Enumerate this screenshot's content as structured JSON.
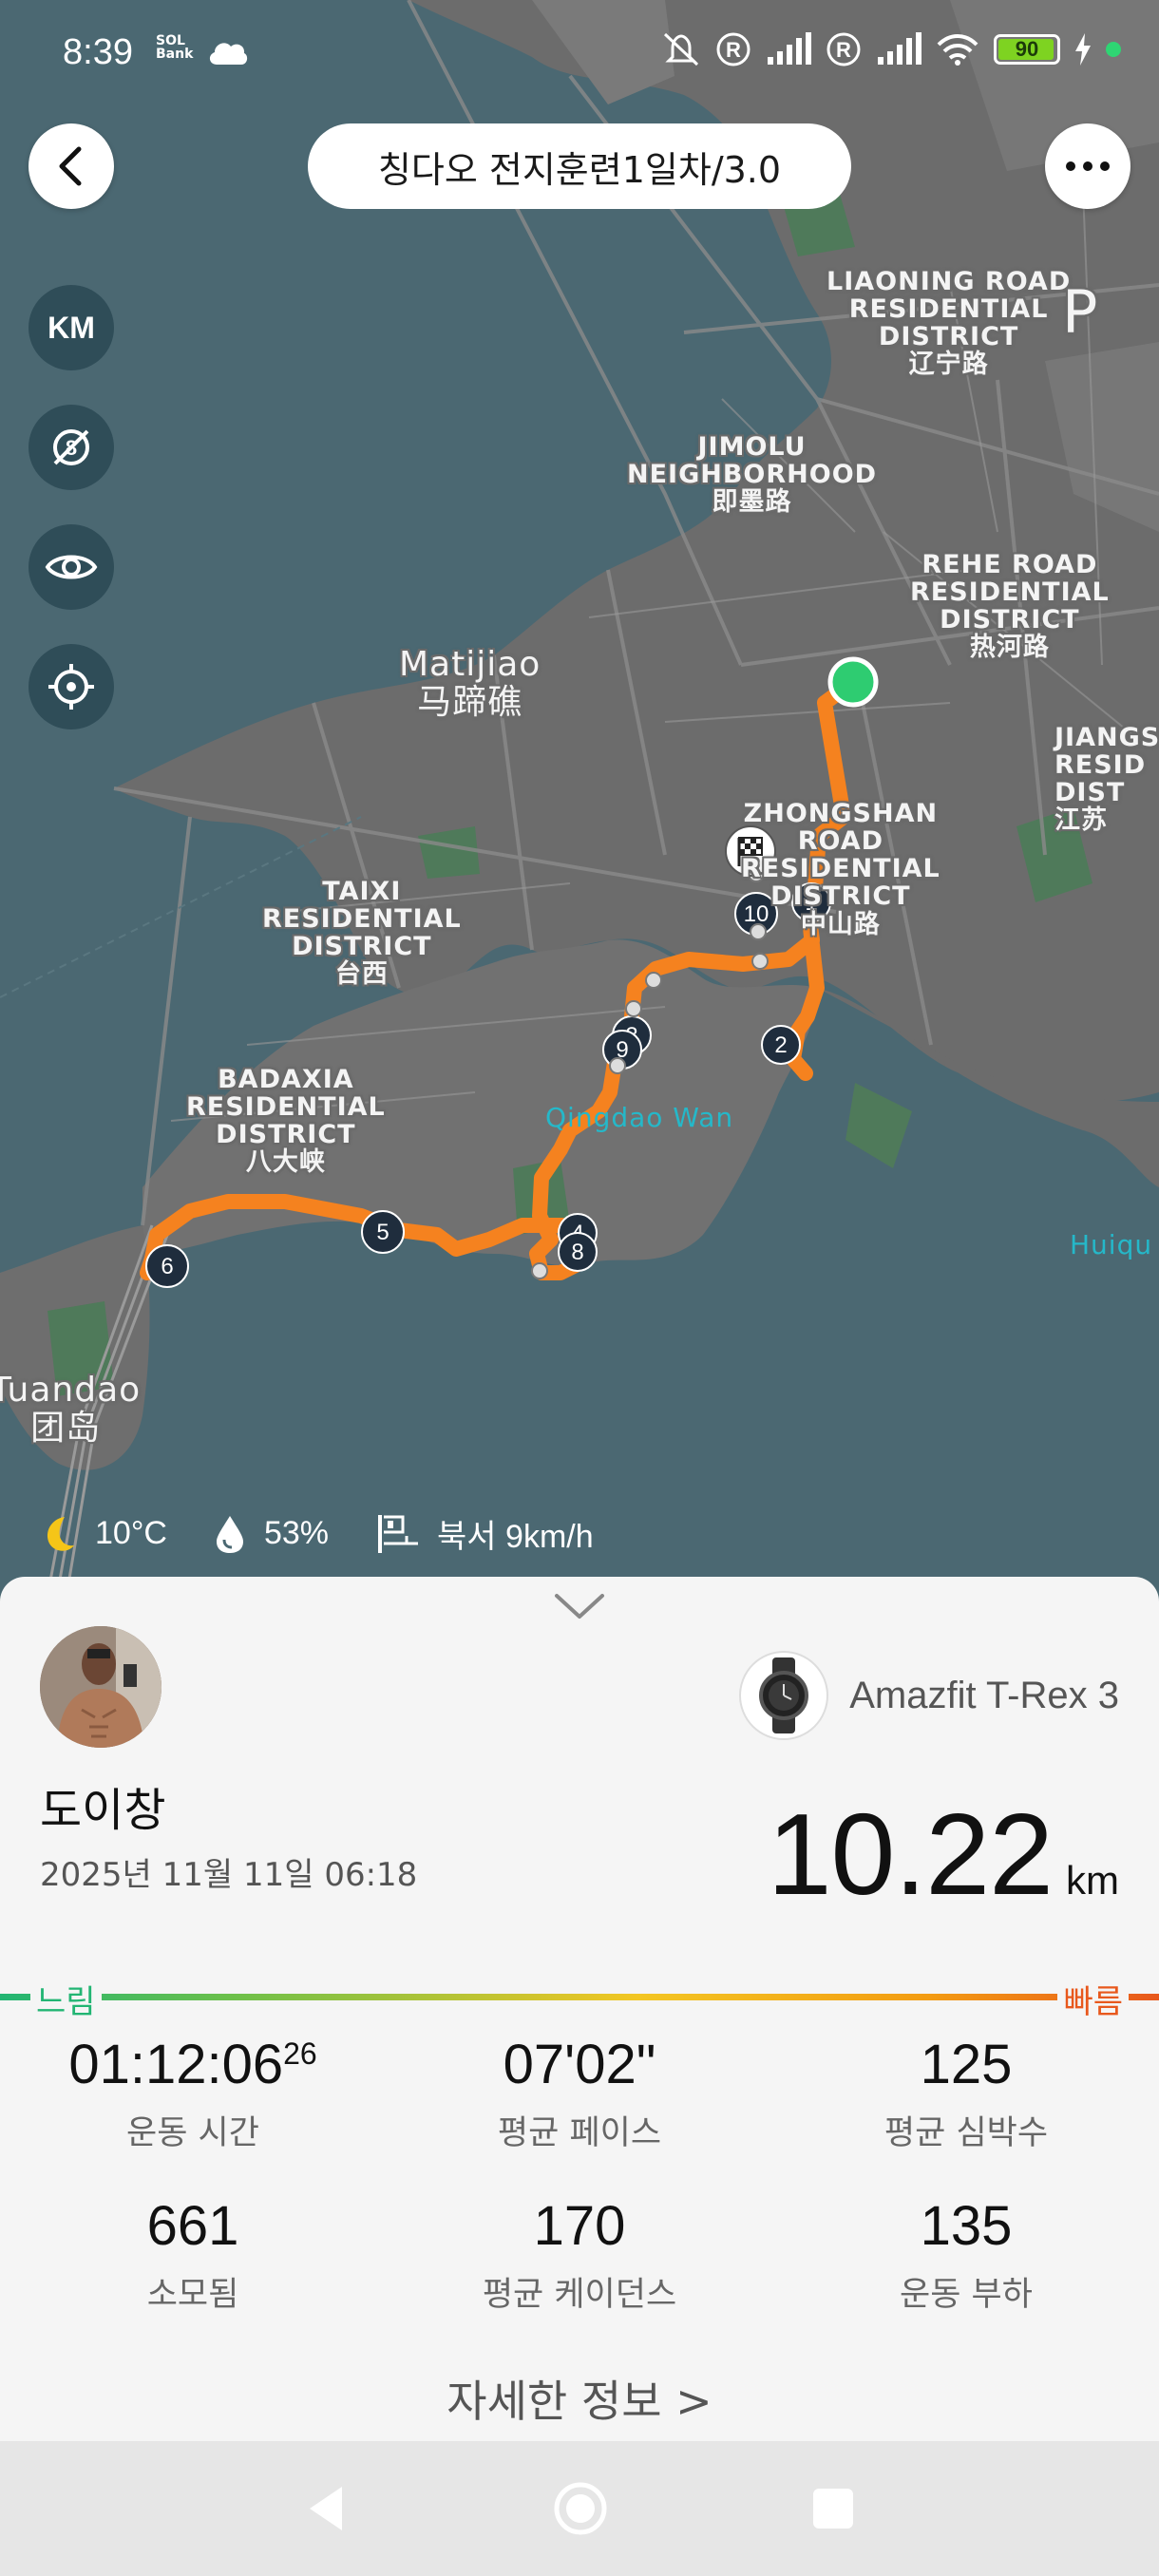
{
  "status_bar": {
    "time": "8:39",
    "bank_text": "SOL Bank",
    "battery": "90"
  },
  "header": {
    "title": "칭다오 전지훈련1일차/3.0"
  },
  "map_controls": {
    "units": "KM"
  },
  "map": {
    "labels": {
      "liaoning": "LIAONING ROAD\nRESIDENTIAL\nDISTRICT\n辽宁路",
      "jimolu": "JIMOLU\nNEIGHBORHOOD\n即墨路",
      "rehe": "REHE ROAD\nRESIDENTIAL\nDISTRICT\n热河路",
      "jiangsu": "JIANGS\nRESID\nDIST\n江苏",
      "matijiao": "Matijiao\n马蹄礁",
      "zhongshan": "ZHONGSHAN\nROAD\nRESIDENTIAL\nDISTRICT\n中山路",
      "taixi": "TAIXI\nRESIDENTIAL\nDISTRICT\n台西",
      "badaxia": "BADAXIA\nRESIDENTIAL\nDISTRICT\n八大峡",
      "tuandao": "Tuandao\n团岛",
      "qingdao_wan": "Qingdao Wan",
      "huiquan": "Huiqu",
      "letter_p": "P"
    },
    "km_markers": [
      "1",
      "2",
      "3",
      "4",
      "5",
      "6",
      "8",
      "9",
      "10"
    ]
  },
  "weather": {
    "temperature": "10°C",
    "humidity": "53%",
    "wind": "북서 9km/h"
  },
  "summary": {
    "device": "Amazfit T-Rex 3",
    "user_name": "도이창",
    "date": "2025년 11월 11일 06:18",
    "distance": "10.22",
    "distance_unit": "km",
    "pace_slow": "느림",
    "pace_fast": "빠름",
    "stats": {
      "duration": "01:12:06",
      "duration_fraction": "26",
      "duration_label": "운동 시간",
      "avg_pace": "07'02\"",
      "avg_pace_label": "평균 페이스",
      "avg_heart_rate": "125",
      "avg_heart_rate_label": "평균 심박수",
      "calories": "661",
      "calories_label": "소모됨",
      "avg_cadence": "170",
      "avg_cadence_label": "평균 케이던스",
      "training_load": "135",
      "training_load_label": "운동 부하"
    },
    "details_link": "자세한 정보 >"
  },
  "colors": {
    "route": "#f5821f",
    "start": "#2ecc71",
    "water": "#4b6872",
    "land": "#6f6f6f"
  }
}
